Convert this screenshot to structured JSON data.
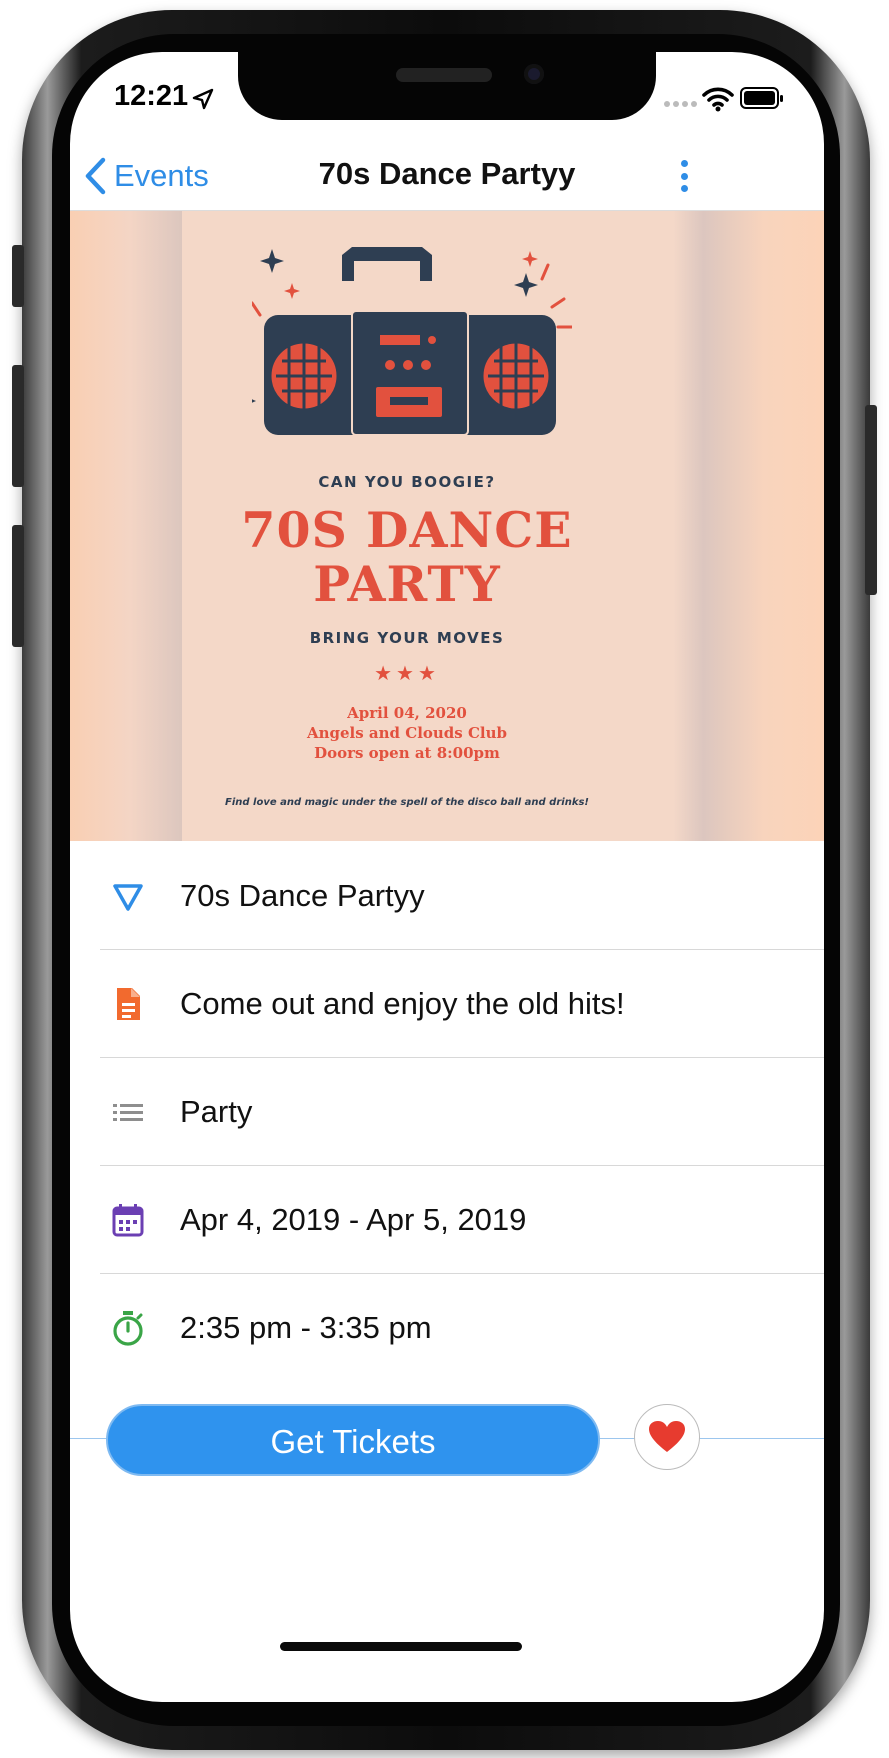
{
  "status_bar": {
    "time": "12:21"
  },
  "nav": {
    "back_label": "Events",
    "title": "70s Dance Partyy"
  },
  "poster": {
    "tagline_top": "CAN YOU BOOGIE?",
    "headline_line1": "70S DANCE",
    "headline_line2": "PARTY",
    "tagline_bottom": "BRING YOUR MOVES",
    "stars": "★★★",
    "date": "April 04, 2020",
    "venue": "Angels and Clouds Club",
    "doors": "Doors open at 8:00pm",
    "footer": "Find love and magic under the spell of the disco ball and drinks!"
  },
  "details": [
    {
      "icon": "triangle-icon",
      "text": "70s Dance Partyy"
    },
    {
      "icon": "document-icon",
      "text": "Come out and enjoy the old hits!"
    },
    {
      "icon": "list-icon",
      "text": "Party"
    },
    {
      "icon": "calendar-icon",
      "text": "Apr 4, 2019 - Apr 5, 2019"
    },
    {
      "icon": "timer-icon",
      "text": "2:35 pm - 3:35 pm"
    }
  ],
  "actions": {
    "tickets_label": "Get Tickets",
    "favorite_icon": "heart-icon"
  },
  "colors": {
    "accent": "#2f8de6",
    "button": "#2f93ee",
    "heart": "#e73b2f",
    "doc_icon": "#f26a2e",
    "calendar_icon": "#6b3fb3",
    "timer_icon": "#3aa547"
  }
}
